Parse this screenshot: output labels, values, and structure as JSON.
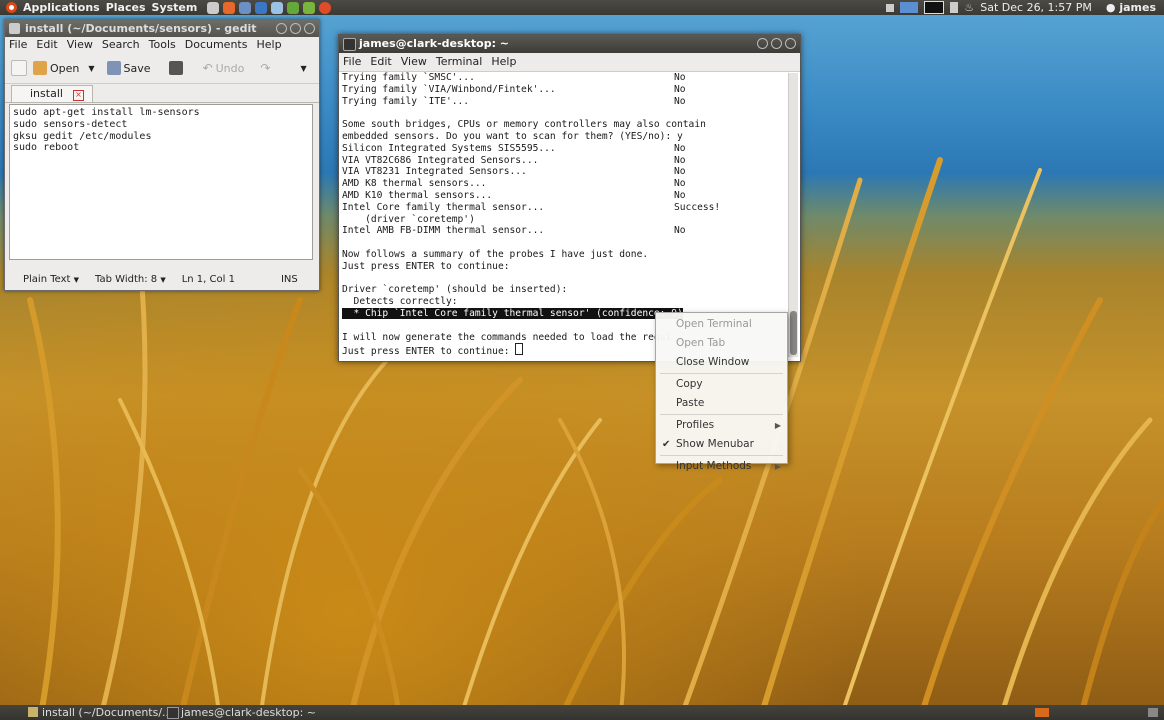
{
  "top_panel": {
    "menus": [
      "Applications",
      "Places",
      "System"
    ],
    "datetime": "Sat Dec 26,  1:57 PM",
    "user": "james"
  },
  "gedit": {
    "title": "install (~/Documents/sensors) - gedit",
    "menus": [
      "File",
      "Edit",
      "View",
      "Search",
      "Tools",
      "Documents",
      "Help"
    ],
    "toolbar": {
      "open": "Open",
      "save": "Save",
      "undo": "Undo"
    },
    "tab": "install",
    "lines": [
      "sudo apt-get install lm-sensors",
      "",
      "sudo sensors-detect",
      "",
      "gksu gedit /etc/modules",
      "",
      "sudo reboot"
    ],
    "status": {
      "mode": "Plain Text",
      "tabwidth": "Tab Width:  8",
      "position": "Ln 1, Col 1",
      "ins": "INS"
    }
  },
  "terminal": {
    "title": "james@clark-desktop: ~",
    "menus": [
      "File",
      "Edit",
      "View",
      "Terminal",
      "Help"
    ],
    "lines": [
      {
        "text": "Trying family `SMSC'...",
        "result": "No"
      },
      {
        "text": "Trying family `VIA/Winbond/Fintek'...",
        "result": "No"
      },
      {
        "text": "Trying family `ITE'...",
        "result": "No"
      },
      {
        "text": "",
        "result": ""
      },
      {
        "text": "Some south bridges, CPUs or memory controllers may also contain",
        "result": ""
      },
      {
        "text": "embedded sensors. Do you want to scan for them? (YES/no): y",
        "result": ""
      },
      {
        "text": "Silicon Integrated Systems SIS5595...",
        "result": "No"
      },
      {
        "text": "VIA VT82C686 Integrated Sensors...",
        "result": "No"
      },
      {
        "text": "VIA VT8231 Integrated Sensors...",
        "result": "No"
      },
      {
        "text": "AMD K8 thermal sensors...",
        "result": "No"
      },
      {
        "text": "AMD K10 thermal sensors...",
        "result": "No"
      },
      {
        "text": "Intel Core family thermal sensor...",
        "result": "Success!"
      },
      {
        "text": "    (driver `coretemp')",
        "result": ""
      },
      {
        "text": "Intel AMB FB-DIMM thermal sensor...",
        "result": "No"
      },
      {
        "text": "",
        "result": ""
      },
      {
        "text": "Now follows a summary of the probes I have just done.",
        "result": ""
      },
      {
        "text": "Just press ENTER to continue:",
        "result": ""
      },
      {
        "text": "",
        "result": ""
      },
      {
        "text": "Driver `coretemp' (should be inserted):",
        "result": ""
      },
      {
        "text": "  Detects correctly:",
        "result": ""
      },
      {
        "text": "",
        "result": ""
      },
      {
        "text": "",
        "result": ""
      },
      {
        "text": "I will now generate the commands needed to load the requi",
        "result": ""
      },
      {
        "text": "Just press ENTER to continue: ",
        "result": ""
      }
    ],
    "highlighted": "  * Chip `Intel Core family thermal sensor' (confidence: 9)"
  },
  "context_menu": [
    {
      "label": "Open Terminal",
      "disabled": true
    },
    {
      "label": "Open Tab",
      "disabled": true
    },
    {
      "label": "Close Window",
      "disabled": false
    },
    {
      "sep": true
    },
    {
      "label": "Copy",
      "disabled": false
    },
    {
      "label": "Paste",
      "disabled": false
    },
    {
      "sep": true
    },
    {
      "label": "Profiles",
      "submenu": true
    },
    {
      "label": "Show Menubar",
      "checked": true
    },
    {
      "sep": true
    },
    {
      "label": "Input Methods",
      "submenu": true
    }
  ],
  "bottom_panel": {
    "tasks": [
      "install (~/Documents/...",
      "james@clark-desktop: ~"
    ]
  }
}
